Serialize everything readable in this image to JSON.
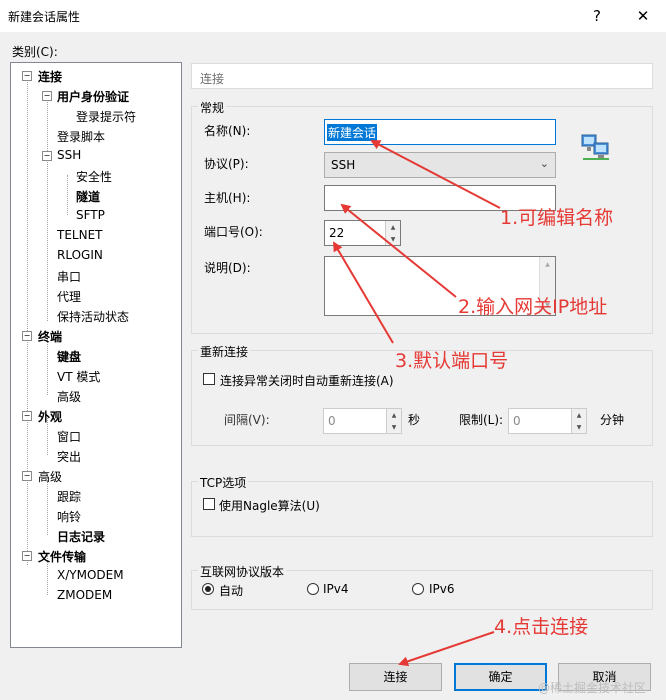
{
  "window": {
    "title": "新建会话属性",
    "help_btn": "?",
    "close_btn": "✕"
  },
  "category_label": "类别(C):",
  "tree": [
    {
      "label": "连接",
      "bold": true
    },
    {
      "label": "用户身份验证",
      "bold": true
    },
    {
      "label": "登录提示符",
      "bold": false
    },
    {
      "label": "登录脚本",
      "bold": false
    },
    {
      "label": "SSH",
      "bold": false
    },
    {
      "label": "安全性",
      "bold": false
    },
    {
      "label": "隧道",
      "bold": true
    },
    {
      "label": "SFTP",
      "bold": false
    },
    {
      "label": "TELNET",
      "bold": false
    },
    {
      "label": "RLOGIN",
      "bold": false
    },
    {
      "label": "串口",
      "bold": false
    },
    {
      "label": "代理",
      "bold": false
    },
    {
      "label": "保持活动状态",
      "bold": false
    },
    {
      "label": "终端",
      "bold": true
    },
    {
      "label": "键盘",
      "bold": true
    },
    {
      "label": "VT 模式",
      "bold": false
    },
    {
      "label": "高级",
      "bold": false
    },
    {
      "label": "外观",
      "bold": true
    },
    {
      "label": "窗口",
      "bold": false
    },
    {
      "label": "突出",
      "bold": false
    },
    {
      "label": "高级",
      "bold": false
    },
    {
      "label": "跟踪",
      "bold": false
    },
    {
      "label": "响铃",
      "bold": false
    },
    {
      "label": "日志记录",
      "bold": true
    },
    {
      "label": "文件传输",
      "bold": true
    },
    {
      "label": "X/YMODEM",
      "bold": false
    },
    {
      "label": "ZMODEM",
      "bold": false
    }
  ],
  "header": "连接",
  "general": {
    "title": "常规",
    "name_label": "名称(N):",
    "name_value": "新建会话",
    "protocol_label": "协议(P):",
    "protocol_value": "SSH",
    "host_label": "主机(H):",
    "host_value": "",
    "port_label": "端口号(O):",
    "port_value": "22",
    "desc_label": "说明(D):",
    "desc_value": ""
  },
  "reconnect": {
    "title": "重新连接",
    "checkbox_label": "连接异常关闭时自动重新连接(A)",
    "interval_label": "间隔(V):",
    "interval_value": "0",
    "interval_unit": "秒",
    "limit_label": "限制(L):",
    "limit_value": "0",
    "limit_unit": "分钟"
  },
  "tcp": {
    "title": "TCP选项",
    "nagle_label": "使用Nagle算法(U)"
  },
  "ipver": {
    "title": "互联网协议版本",
    "options": [
      "自动",
      "IPv4",
      "IPv6"
    ],
    "selected": "自动"
  },
  "buttons": {
    "connect": "连接",
    "ok": "确定",
    "cancel": "取消"
  },
  "annotations": [
    "1.可编辑名称",
    "2.输入网关IP地址",
    "3.默认端口号",
    "4.点击连接"
  ],
  "watermark": "@稀土掘金技术社区",
  "colors": {
    "annotation": "#e53935",
    "accent": "#0078d7"
  }
}
